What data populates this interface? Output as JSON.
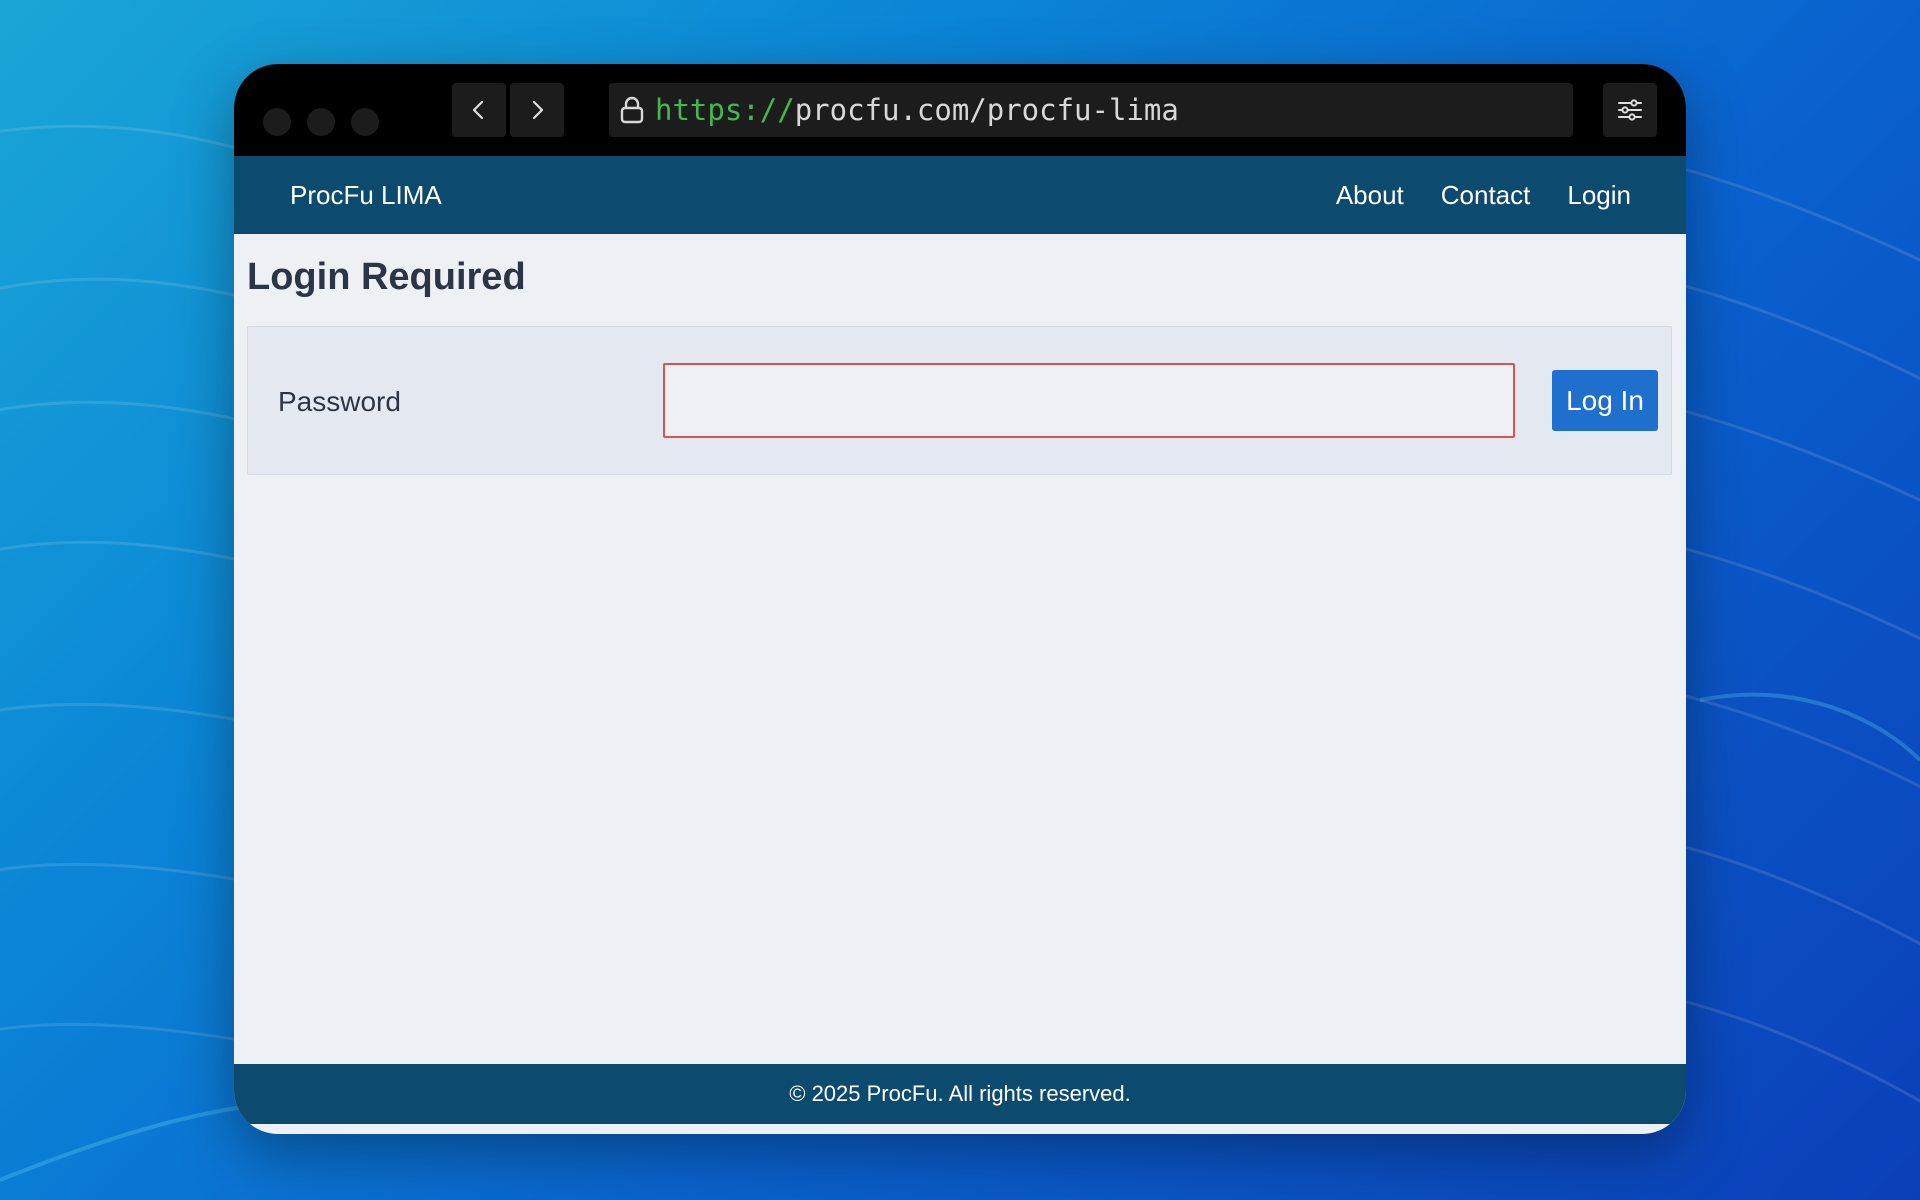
{
  "browser": {
    "url_scheme": "https://",
    "url_rest": "procfu.com/procfu-lima"
  },
  "site_nav": {
    "brand": "ProcFu LIMA",
    "links": [
      {
        "label": "About"
      },
      {
        "label": "Contact"
      },
      {
        "label": "Login"
      }
    ]
  },
  "main": {
    "title": "Login Required",
    "password_label": "Password",
    "password_value": "",
    "submit_label": "Log In"
  },
  "footer": {
    "text": "© 2025 ProcFu. All rights reserved."
  },
  "colors": {
    "navbar": "#0c4a6e",
    "button": "#1e6fce",
    "input_border": "#d9534f",
    "url_scheme": "#3fb950"
  },
  "icons": {
    "back": "chevron-left-icon",
    "forward": "chevron-right-icon",
    "lock": "lock-icon",
    "menu": "sliders-icon"
  }
}
